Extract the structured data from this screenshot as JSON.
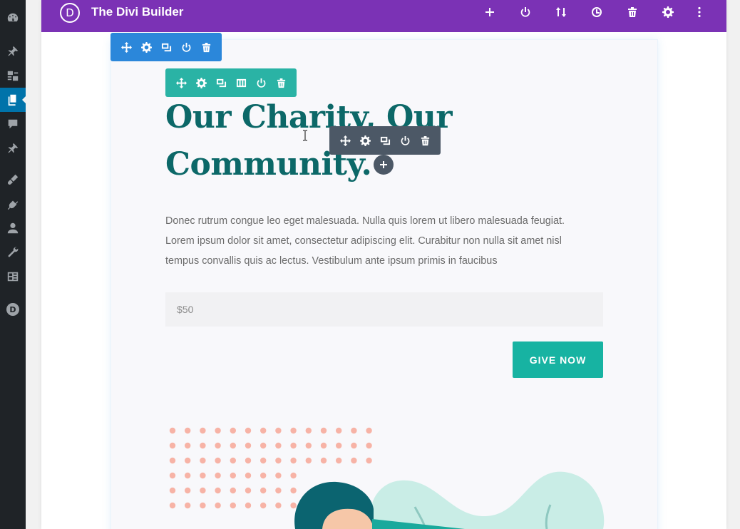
{
  "builder": {
    "title": "The Divi Builder",
    "logo_letter": "D",
    "bar_icons": [
      "plus-icon",
      "power-icon",
      "sort-icon",
      "history-icon",
      "trash-icon",
      "gear-icon",
      "more-vertical-icon"
    ]
  },
  "wp_sidebar": {
    "items": [
      "dashboard-icon",
      "pin-icon",
      "media-icon",
      "pages-icon",
      "comments-icon",
      "pin-icon",
      "appearance-icon",
      "plugins-icon",
      "users-icon",
      "tools-icon",
      "settings-icon",
      "divi-icon"
    ],
    "active_index": 3
  },
  "toolbars": {
    "section": [
      "move-icon",
      "gear-icon",
      "duplicate-icon",
      "power-icon",
      "trash-icon"
    ],
    "row": [
      "move-icon",
      "gear-icon",
      "duplicate-icon",
      "columns-icon",
      "power-icon",
      "trash-icon"
    ],
    "module": [
      "move-icon",
      "gear-icon",
      "duplicate-icon",
      "power-icon",
      "trash-icon"
    ]
  },
  "content": {
    "heading_line1": "Our Charity, Our",
    "heading_line2": "Community.",
    "body_line1": "Donec rutrum congue leo eget malesuada. Nulla quis lorem ut libero malesuada feugiat.",
    "body_line2": "Lorem ipsum dolor sit amet, consectetur adipiscing elit. Curabitur non nulla sit amet nisl",
    "body_line3": "tempus convallis quis ac lectus.  Vestibulum ante ipsum primis in faucibus",
    "amount_placeholder": "$50",
    "give_button": "GIVE NOW"
  },
  "colors": {
    "divi_purple": "#7b32b5",
    "section_blue": "#2b87da",
    "row_teal": "#2ab3a5",
    "module_gray": "#4c5866",
    "heading_teal": "#0c6868",
    "button_teal": "#17b3a2"
  }
}
